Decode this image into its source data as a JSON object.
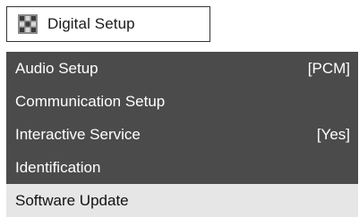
{
  "header": {
    "title": "Digital Setup",
    "icon": "settings-grid-icon"
  },
  "menu": {
    "items": [
      {
        "label": "Audio Setup",
        "value": "[PCM]"
      },
      {
        "label": "Communication Setup",
        "value": ""
      },
      {
        "label": "Interactive Service",
        "value": "[Yes]"
      },
      {
        "label": "Identification",
        "value": ""
      },
      {
        "label": "Software Update",
        "value": ""
      }
    ],
    "selected_index": 4
  },
  "colors": {
    "menu_background": "#4b4b4b",
    "selected_background": "#e6e6e6",
    "menu_text": "#ffffff",
    "selected_text": "#111111"
  }
}
